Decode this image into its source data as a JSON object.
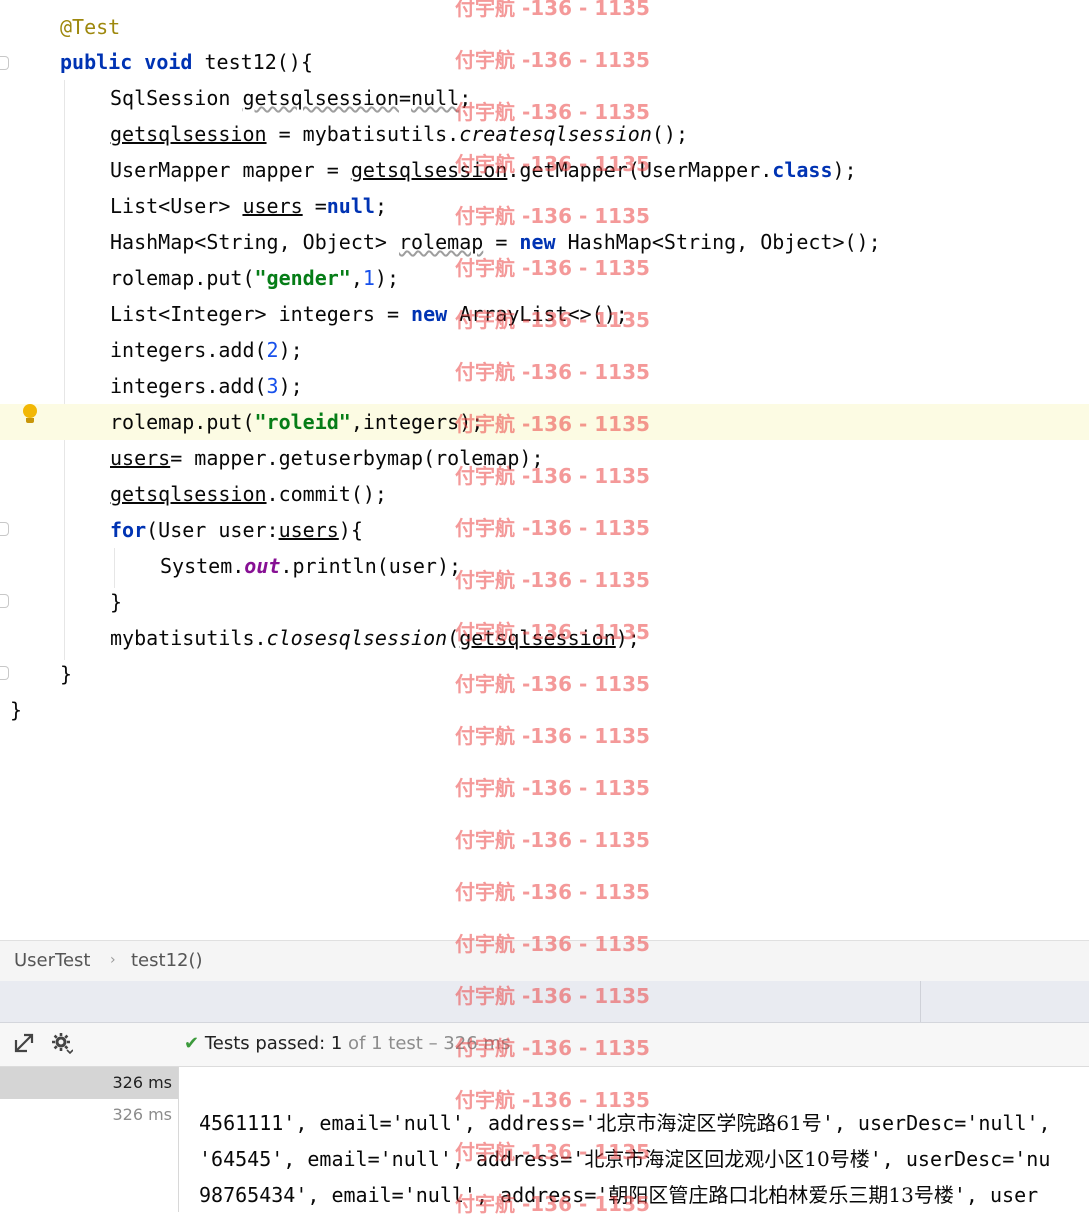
{
  "editor": {
    "lines": [
      {
        "id": "l1",
        "tokens": [
          [
            "ann",
            "@Test"
          ]
        ]
      },
      {
        "id": "l2",
        "tokens": [
          [
            "kw",
            "public "
          ],
          [
            "kw",
            "void "
          ],
          [
            "t",
            "test12(){"
          ]
        ]
      },
      {
        "id": "l3",
        "tokens": [
          [
            "t",
            "SqlSession "
          ],
          [
            "squig",
            "getsqlsession"
          ],
          [
            "t",
            "="
          ],
          [
            "kw",
            ""
          ],
          [
            "squig",
            "null"
          ],
          [
            "t",
            ";"
          ]
        ]
      },
      {
        "id": "l4",
        "tokens": [
          [
            "ul",
            "getsqlsession"
          ],
          [
            "t",
            " = mybatisutils."
          ],
          [
            "ital",
            "createsqlsession"
          ],
          [
            "t",
            "();"
          ]
        ]
      },
      {
        "id": "l5",
        "tokens": [
          [
            "t",
            "UserMapper mapper = "
          ],
          [
            "ul",
            "getsqlsession"
          ],
          [
            "t",
            ".getMapper(UserMapper."
          ],
          [
            "kw",
            "class"
          ],
          [
            "t",
            ");"
          ]
        ]
      },
      {
        "id": "l6",
        "tokens": [
          [
            "t",
            "List<User> "
          ],
          [
            "ul",
            "users"
          ],
          [
            "t",
            " ="
          ],
          [
            "kw",
            "null"
          ],
          [
            "t",
            ";"
          ]
        ]
      },
      {
        "id": "l7",
        "tokens": [
          [
            "t",
            "HashMap<String, Object> "
          ],
          [
            "squig",
            "rolemap"
          ],
          [
            "t",
            " = "
          ],
          [
            "kw",
            "new"
          ],
          [
            "t",
            " HashMap<String, Object>();"
          ]
        ]
      },
      {
        "id": "l8",
        "tokens": [
          [
            "t",
            "rolemap.put("
          ],
          [
            "str",
            "\"gender\""
          ],
          [
            "t",
            ","
          ],
          [
            "num",
            "1"
          ],
          [
            "t",
            ");"
          ]
        ]
      },
      {
        "id": "l9",
        "tokens": [
          [
            "t",
            "List<Integer> integers = "
          ],
          [
            "kw",
            "new"
          ],
          [
            "t",
            " ArrayList<>();"
          ]
        ]
      },
      {
        "id": "l10",
        "tokens": [
          [
            "t",
            "integers.add("
          ],
          [
            "num",
            "2"
          ],
          [
            "t",
            ");"
          ]
        ]
      },
      {
        "id": "l11",
        "tokens": [
          [
            "t",
            "integers.add("
          ],
          [
            "num",
            "3"
          ],
          [
            "t",
            ");"
          ]
        ]
      },
      {
        "id": "l12",
        "tokens": [
          [
            "t",
            "rolemap.put("
          ],
          [
            "str",
            "\"roleid\""
          ],
          [
            "t",
            ",integers);"
          ]
        ]
      },
      {
        "id": "l13",
        "tokens": [
          [
            "ul",
            "users"
          ],
          [
            "t",
            "= mapper.getuserbymap(rolemap);"
          ]
        ]
      },
      {
        "id": "l14",
        "tokens": [
          [
            "ul",
            "getsqlsession"
          ],
          [
            "t",
            ".commit();"
          ]
        ]
      },
      {
        "id": "l15",
        "tokens": [
          [
            "kw",
            "for"
          ],
          [
            "t",
            "(User user:"
          ],
          [
            "ul",
            "users"
          ],
          [
            "t",
            "){"
          ]
        ]
      },
      {
        "id": "l16",
        "tokens": [
          [
            "t",
            "System."
          ],
          [
            "field",
            "out"
          ],
          [
            "t",
            ".println(user);"
          ]
        ]
      },
      {
        "id": "l17",
        "tokens": [
          [
            "t",
            "}"
          ]
        ]
      },
      {
        "id": "l18",
        "tokens": [
          [
            "t",
            "mybatisutils."
          ],
          [
            "ital",
            "closesqlsession"
          ],
          [
            "t",
            "("
          ],
          [
            "ul",
            "getsqlsession"
          ],
          [
            "t",
            ");"
          ]
        ]
      },
      {
        "id": "l19",
        "tokens": [
          [
            "t",
            "}"
          ]
        ]
      },
      {
        "id": "l20",
        "tokens": [
          [
            "t",
            "}"
          ]
        ]
      }
    ]
  },
  "breadcrumb": {
    "class_name": "UserTest",
    "separator": "›",
    "method_name": "test12()"
  },
  "run_toolbar": {
    "status_prefix": "Tests passed: ",
    "passed_count": "1",
    "status_suffix": " of 1 test – 326 ms"
  },
  "test_tree": [
    {
      "duration": "326 ms"
    },
    {
      "duration": "326 ms"
    }
  ],
  "console": [
    {
      "pre": "4561111', email='null', address='",
      "cjk": "北京市海淀区学院路61号",
      "post": "', userDesc='null',"
    },
    {
      "pre": "'64545', email='null', address='",
      "cjk": "北京市海淀区回龙观小区10号楼",
      "post": "', userDesc='nu"
    },
    {
      "pre": "98765434', email='null', address='",
      "cjk": "朝阳区管庄路口北柏林爱乐三期13号楼",
      "post": "', user"
    }
  ],
  "watermark": "付宇航 -136 - 1135",
  "icons": {
    "export": "export-icon",
    "settings": "gear-icon",
    "passed": "check-icon",
    "hint": "lightbulb-icon"
  }
}
